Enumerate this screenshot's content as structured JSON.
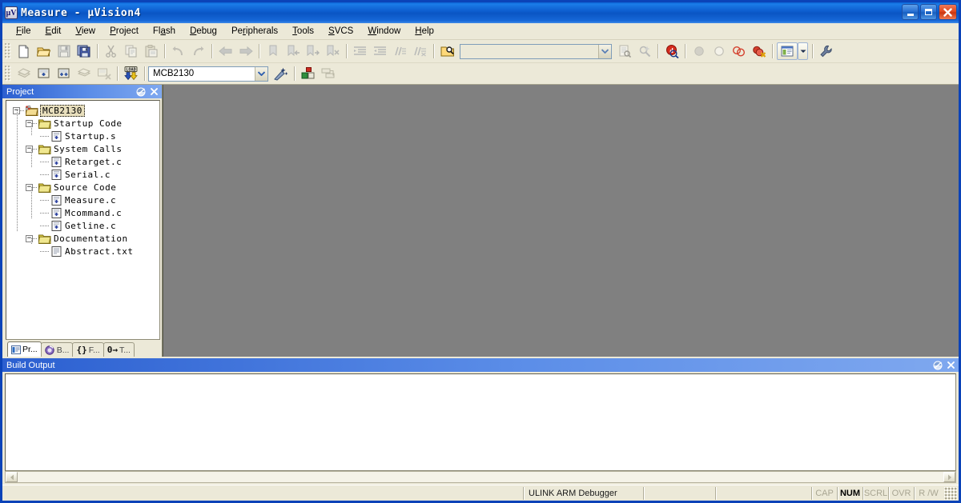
{
  "window": {
    "title": "Measure  -  µVision4",
    "app_icon_text": "µV",
    "minimize_label": "Minimize",
    "maximize_label": "Maximize",
    "close_label": "Close"
  },
  "menubar": {
    "items": [
      {
        "label": "File",
        "accel": "F"
      },
      {
        "label": "Edit",
        "accel": "E"
      },
      {
        "label": "View",
        "accel": "V"
      },
      {
        "label": "Project",
        "accel": "P"
      },
      {
        "label": "Flash",
        "accel": "a"
      },
      {
        "label": "Debug",
        "accel": "D"
      },
      {
        "label": "Peripherals",
        "accel": "r"
      },
      {
        "label": "Tools",
        "accel": "T"
      },
      {
        "label": "SVCS",
        "accel": "S"
      },
      {
        "label": "Window",
        "accel": "W"
      },
      {
        "label": "Help",
        "accel": "H"
      }
    ]
  },
  "toolbar_file": {
    "buttons": [
      {
        "name": "new-file-icon",
        "tip": "New"
      },
      {
        "name": "open-file-icon",
        "tip": "Open"
      },
      {
        "name": "save-icon",
        "tip": "Save"
      },
      {
        "name": "save-all-icon",
        "tip": "Save All"
      },
      {
        "name": "cut-icon",
        "tip": "Cut"
      },
      {
        "name": "copy-icon",
        "tip": "Copy"
      },
      {
        "name": "paste-icon",
        "tip": "Paste"
      },
      {
        "name": "undo-icon",
        "tip": "Undo"
      },
      {
        "name": "redo-icon",
        "tip": "Redo"
      },
      {
        "name": "navigate-back-icon",
        "tip": "Back"
      },
      {
        "name": "navigate-forward-icon",
        "tip": "Forward"
      },
      {
        "name": "bookmark-toggle-icon",
        "tip": "Insert/Remove Bookmark"
      },
      {
        "name": "bookmark-prev-icon",
        "tip": "Previous Bookmark"
      },
      {
        "name": "bookmark-next-icon",
        "tip": "Next Bookmark"
      },
      {
        "name": "bookmark-clear-icon",
        "tip": "Clear All Bookmarks"
      },
      {
        "name": "indent-icon",
        "tip": "Indent Selection"
      },
      {
        "name": "outdent-icon",
        "tip": "Outdent Selection"
      },
      {
        "name": "comment-icon",
        "tip": "Comment Selection"
      },
      {
        "name": "uncomment-icon",
        "tip": "Uncomment Selection"
      },
      {
        "name": "find-in-files-icon",
        "tip": "Find in Files"
      }
    ],
    "search_value": "",
    "search_placeholder": "",
    "after_search": [
      {
        "name": "find-icon",
        "tip": "Find"
      },
      {
        "name": "incremental-find-icon",
        "tip": "Incremental Find"
      }
    ],
    "debug_buttons": [
      {
        "name": "start-debug-icon",
        "tip": "Start/Stop Debug Session"
      },
      {
        "name": "insert-breakpoint-icon",
        "tip": "Insert/Remove Breakpoint"
      },
      {
        "name": "enable-breakpoint-icon",
        "tip": "Enable/Disable Breakpoint"
      },
      {
        "name": "disable-all-breakpoints-icon",
        "tip": "Disable All Breakpoints"
      },
      {
        "name": "kill-all-breakpoints-icon",
        "tip": "Kill All Breakpoints"
      }
    ],
    "window_button": {
      "name": "window-layout-icon",
      "tip": "Manage Window Layouts"
    },
    "config_button": {
      "name": "configuration-wrench-icon",
      "tip": "Configuration"
    }
  },
  "toolbar_build": {
    "buttons": [
      {
        "name": "translate-icon",
        "tip": "Translate Current File"
      },
      {
        "name": "build-target-icon",
        "tip": "Build Target"
      },
      {
        "name": "rebuild-all-icon",
        "tip": "Rebuild All Target Files"
      },
      {
        "name": "batch-build-icon",
        "tip": "Batch Build"
      },
      {
        "name": "stop-build-icon",
        "tip": "Stop Build"
      },
      {
        "name": "load-download-icon",
        "tip": "Download to Flash"
      }
    ],
    "target_value": "MCB2130",
    "target_label": "Select Target",
    "after": [
      {
        "name": "target-options-wizard-icon",
        "tip": "Options for Target"
      },
      {
        "name": "manage-components-icon",
        "tip": "Manage Components"
      },
      {
        "name": "multi-project-icon",
        "tip": "Manage Multi-Project Workspace"
      }
    ]
  },
  "project_panel": {
    "caption": "Project",
    "roll_button": "roll-up-icon",
    "close_button": "close-icon",
    "tree": {
      "root": {
        "label": "MCB2130",
        "icon": "target-icon",
        "selected": true,
        "expanded": true
      },
      "groups": [
        {
          "label": "Startup Code",
          "icon": "folder-icon",
          "expanded": true,
          "files": [
            {
              "label": "Startup.s",
              "icon": "source-file-icon"
            }
          ]
        },
        {
          "label": "System Calls",
          "icon": "folder-icon",
          "expanded": true,
          "files": [
            {
              "label": "Retarget.c",
              "icon": "source-file-icon"
            },
            {
              "label": "Serial.c",
              "icon": "source-file-icon"
            }
          ]
        },
        {
          "label": "Source Code",
          "icon": "folder-icon",
          "expanded": true,
          "files": [
            {
              "label": "Measure.c",
              "icon": "source-file-icon"
            },
            {
              "label": "Mcommand.c",
              "icon": "source-file-icon"
            },
            {
              "label": "Getline.c",
              "icon": "source-file-icon"
            }
          ]
        },
        {
          "label": "Documentation",
          "icon": "folder-icon",
          "expanded": true,
          "files": [
            {
              "label": "Abstract.txt",
              "icon": "text-file-icon"
            }
          ]
        }
      ]
    },
    "tabs": [
      {
        "label": "Pr...",
        "icon": "project-tab-icon",
        "active": true
      },
      {
        "label": "B...",
        "icon": "books-tab-icon",
        "active": false
      },
      {
        "label": "F...",
        "icon": "functions-tab-icon",
        "active": false
      },
      {
        "label": "T...",
        "icon": "templates-tab-icon",
        "active": false
      }
    ]
  },
  "build_output": {
    "caption": "Build Output",
    "roll_button": "roll-up-icon",
    "close_button": "close-icon",
    "content": "",
    "scroll_left": "scroll-left-icon",
    "scroll_right": "scroll-right-icon"
  },
  "statusbar": {
    "message": "",
    "debugger": "ULINK ARM Debugger",
    "pane2": "",
    "pane3": "",
    "indicators": [
      {
        "label": "CAP",
        "active": false
      },
      {
        "label": "NUM",
        "active": true
      },
      {
        "label": "SCRL",
        "active": false
      },
      {
        "label": "OVR",
        "active": false
      },
      {
        "label": "R /W",
        "active": false
      }
    ]
  },
  "colors": {
    "title_blue": "#0A55C4",
    "panel_caption_blue": "#2B5FD0",
    "face": "#ECE9D8",
    "mdi_grey": "#808080",
    "selection_tan": "#E8DFBD"
  }
}
